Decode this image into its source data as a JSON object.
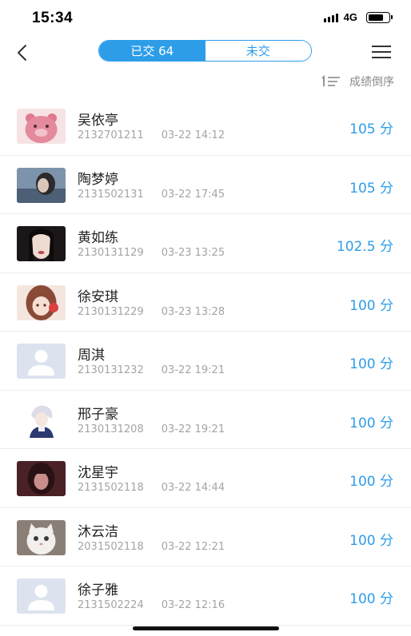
{
  "status_bar": {
    "time": "15:34",
    "network": "4G",
    "battery_level": 0.8
  },
  "nav": {
    "back_icon": "chevron-left-icon",
    "tabs": [
      {
        "label": "已交 64",
        "active": true
      },
      {
        "label": "未交",
        "active": false
      }
    ],
    "menu_icon": "hamburger-menu-icon"
  },
  "sort": {
    "icon": "sort-descending-icon",
    "label": "成绩倒序"
  },
  "students": [
    {
      "name": "吴依亭",
      "id": "2132701211",
      "time": "03-22 14:12",
      "score": "105 分",
      "avatar": "cartoon-bear-pink"
    },
    {
      "name": "陶梦婷",
      "id": "2131502131",
      "time": "03-22 17:45",
      "score": "105 分",
      "avatar": "photo-blue-portrait"
    },
    {
      "name": "黄如练",
      "id": "2130131129",
      "time": "03-23 13:25",
      "score": "102.5 分",
      "avatar": "photo-dark-portrait"
    },
    {
      "name": "徐安琪",
      "id": "2130131229",
      "time": "03-23 13:28",
      "score": "100 分",
      "avatar": "cartoon-girl-warm"
    },
    {
      "name": "周淇",
      "id": "2130131232",
      "time": "03-22 19:21",
      "score": "100 分",
      "avatar": "default-user"
    },
    {
      "name": "邢子豪",
      "id": "2130131208",
      "time": "03-22 19:21",
      "score": "100 分",
      "avatar": "anime-character"
    },
    {
      "name": "沈星宇",
      "id": "2131502118",
      "time": "03-22 14:44",
      "score": "100 分",
      "avatar": "photo-dark-red"
    },
    {
      "name": "沐云洁",
      "id": "2031502118",
      "time": "03-22 12:21",
      "score": "100 分",
      "avatar": "photo-white-cat"
    },
    {
      "name": "徐子雅",
      "id": "2131502224",
      "time": "03-22 12:16",
      "score": "100 分",
      "avatar": "default-user"
    }
  ],
  "colors": {
    "accent": "#2d9de8",
    "secondary_text": "#a4a4a4",
    "divider": "#ececec"
  }
}
